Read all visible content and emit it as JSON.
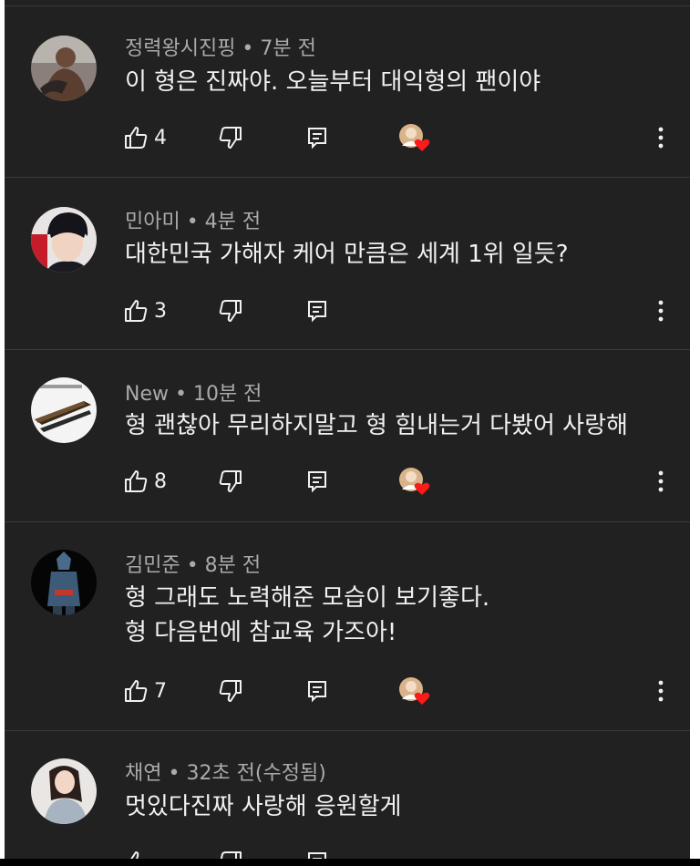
{
  "colors": {
    "background": "#212121",
    "text_primary": "#f1f1f1",
    "text_secondary": "#aaaaaa",
    "divider": "#3a3a3a",
    "heart": "#ff1a1a"
  },
  "comments": [
    {
      "author": "정력왕시진핑",
      "time": "7분 전",
      "meta": "정력왕시진핑 • 7분 전",
      "lines": [
        "이 형은 진짜야. 오늘부터 대익형의 팬이야"
      ],
      "likes": "4",
      "creator_heart": true
    },
    {
      "author": "민아미",
      "time": "4분 전",
      "meta": "민아미 • 4분 전",
      "lines": [
        "대한민국 가해자 케어 만큼은 세계 1위 일듯?"
      ],
      "likes": "3",
      "creator_heart": false
    },
    {
      "author": "New",
      "time": "10분 전",
      "meta": "New • 10분 전",
      "lines": [
        "형 괜찮아 무리하지말고 형 힘내는거 다봤어 사랑해"
      ],
      "likes": "8",
      "creator_heart": true
    },
    {
      "author": "김민준",
      "time": "8분 전",
      "meta": "김민준 • 8분 전",
      "lines": [
        "형 그래도 노력해준 모습이 보기좋다.",
        "형 다음번에 참교육 가즈아!"
      ],
      "likes": "7",
      "creator_heart": true
    },
    {
      "author": "채연",
      "time": "32초 전(수정됨)",
      "meta": "채연 • 32초 전(수정됨)",
      "lines": [
        "멋있다진짜 사랑해 응원할게"
      ],
      "likes": "",
      "creator_heart": false
    }
  ],
  "icons": {
    "like": "thumbs-up-icon",
    "dislike": "thumbs-down-icon",
    "reply": "reply-icon",
    "more": "more-vertical-icon",
    "heart_badge": "creator-heart-icon"
  }
}
